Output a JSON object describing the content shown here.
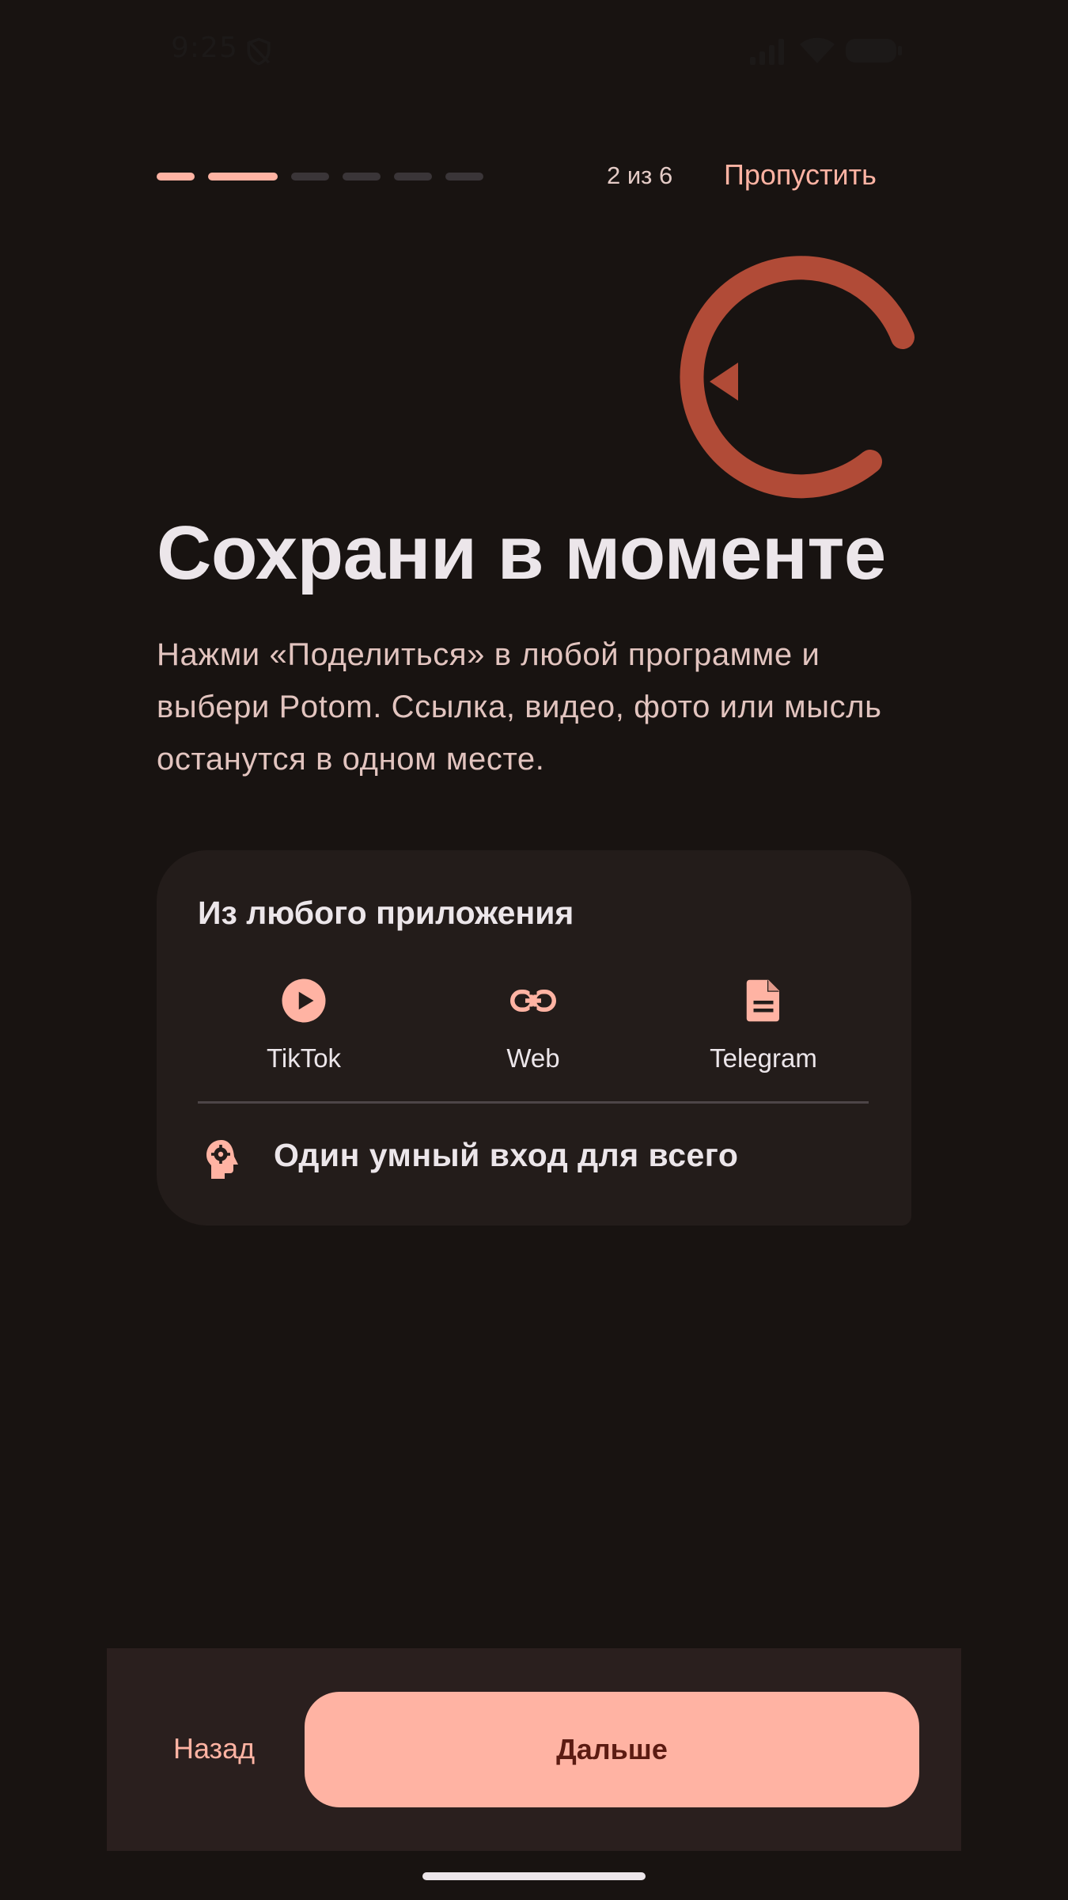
{
  "status_bar": {
    "time": "9:25",
    "icons": [
      "shield-icon",
      "signal-icon",
      "wifi-icon",
      "battery-icon"
    ]
  },
  "onboarding": {
    "step_counter": "2 из 6",
    "current_step": 2,
    "total_steps": 6,
    "skip_label": "Пропустить",
    "title": "Сохрани в моменте",
    "description": "Нажми «Поделиться» в любой программе и выбери Potom. Ссылка, видео, фото или мысль останутся в одном месте."
  },
  "card": {
    "title": "Из любого приложения",
    "sources": [
      {
        "label": "TikTok",
        "icon": "play-circle-icon"
      },
      {
        "label": "Web",
        "icon": "link-icon"
      },
      {
        "label": "Telegram",
        "icon": "document-icon"
      }
    ],
    "feature_text": "Один умный вход для всего",
    "feature_icon": "head-gear-icon"
  },
  "footer": {
    "back_label": "Назад",
    "next_label": "Дальше"
  },
  "colors": {
    "background": "#181311",
    "accent": "#ffb3a3",
    "hero_icon": "#b14b37",
    "card": "#231c1a",
    "bottom_bar": "#2a1f1e"
  }
}
